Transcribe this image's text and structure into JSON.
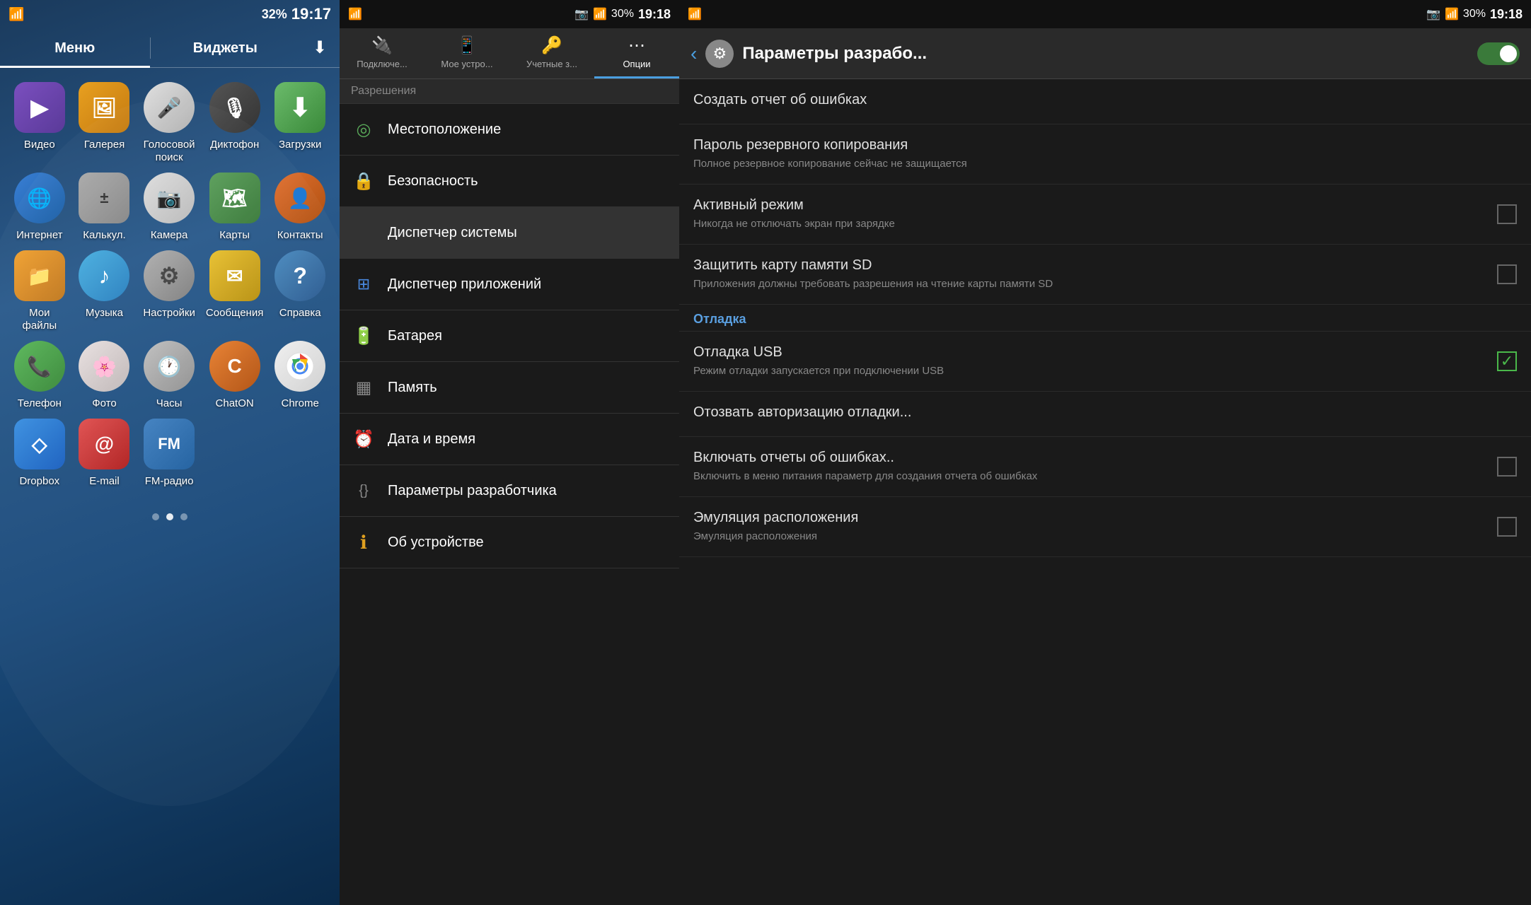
{
  "homeScreen": {
    "statusBar": {
      "time": "19:17",
      "batteryPercent": "32%",
      "wifiIcon": "wifi",
      "signalIcon": "signal"
    },
    "tabs": [
      {
        "id": "menu",
        "label": "Меню",
        "active": true
      },
      {
        "id": "widgets",
        "label": "Виджеты",
        "active": false
      }
    ],
    "downloadIcon": "⬇",
    "apps": [
      {
        "id": "video",
        "label": "Видео",
        "iconClass": "icon-video",
        "icon": "▶"
      },
      {
        "id": "gallery",
        "label": "Галерея",
        "iconClass": "icon-gallery",
        "icon": "🖼"
      },
      {
        "id": "voice",
        "label": "Голосовой поиск",
        "iconClass": "icon-voice",
        "icon": "🎤"
      },
      {
        "id": "dictaphone",
        "label": "Диктофон",
        "iconClass": "icon-dictaphone",
        "icon": "🎙"
      },
      {
        "id": "downloads",
        "label": "Загрузки",
        "iconClass": "icon-download",
        "icon": "⬇"
      },
      {
        "id": "internet",
        "label": "Интернет",
        "iconClass": "icon-internet",
        "icon": "🌐"
      },
      {
        "id": "calculator",
        "label": "Калькул.",
        "iconClass": "icon-calc",
        "icon": "±"
      },
      {
        "id": "camera",
        "label": "Камера",
        "iconClass": "icon-camera",
        "icon": "📷"
      },
      {
        "id": "maps",
        "label": "Карты",
        "iconClass": "icon-maps",
        "icon": "🗺"
      },
      {
        "id": "contacts",
        "label": "Контакты",
        "iconClass": "icon-contacts",
        "icon": "👤"
      },
      {
        "id": "myfiles",
        "label": "Мои файлы",
        "iconClass": "icon-myfiles",
        "icon": "📁"
      },
      {
        "id": "music",
        "label": "Музыка",
        "iconClass": "icon-music",
        "icon": "♪"
      },
      {
        "id": "settings",
        "label": "Настройки",
        "iconClass": "icon-settings",
        "icon": "⚙"
      },
      {
        "id": "messages",
        "label": "Сообщения",
        "iconClass": "icon-messages",
        "icon": "✉"
      },
      {
        "id": "help",
        "label": "Справка",
        "iconClass": "icon-help",
        "icon": "?"
      },
      {
        "id": "phone",
        "label": "Телефон",
        "iconClass": "icon-phone",
        "icon": "📞"
      },
      {
        "id": "photos",
        "label": "Фото",
        "iconClass": "icon-photos",
        "icon": "🌸"
      },
      {
        "id": "clock",
        "label": "Часы",
        "iconClass": "icon-clock",
        "icon": "🕐"
      },
      {
        "id": "chaton",
        "label": "ChatON",
        "iconClass": "icon-chaton",
        "icon": "C"
      },
      {
        "id": "chrome",
        "label": "Chrome",
        "iconClass": "icon-chrome",
        "icon": "◎"
      },
      {
        "id": "dropbox",
        "label": "Dropbox",
        "iconClass": "icon-dropbox",
        "icon": "◇"
      },
      {
        "id": "email",
        "label": "E-mail",
        "iconClass": "icon-email",
        "icon": "@"
      },
      {
        "id": "fmradio",
        "label": "FM-радио",
        "iconClass": "icon-fmradio",
        "icon": "📻"
      }
    ],
    "dots": [
      {
        "active": false
      },
      {
        "active": true
      },
      {
        "active": false
      }
    ]
  },
  "settingsScreen": {
    "statusBar": {
      "time": "19:18",
      "batteryPercent": "30%"
    },
    "tabs": [
      {
        "id": "connections",
        "label": "Подключе...",
        "icon": "🔌",
        "active": false
      },
      {
        "id": "mydevice",
        "label": "Мое устро...",
        "icon": "📱",
        "active": false
      },
      {
        "id": "accounts",
        "label": "Учетные з...",
        "icon": "🔑",
        "active": false
      },
      {
        "id": "options",
        "label": "Опции",
        "icon": "⋯",
        "active": true
      }
    ],
    "sectionHeader": "Разрешения",
    "items": [
      {
        "id": "location",
        "label": "Местоположение",
        "icon": "◎",
        "iconColor": "#5aaa5a",
        "active": false
      },
      {
        "id": "security",
        "label": "Безопасность",
        "icon": "🔒",
        "iconColor": "#4a8ae0",
        "active": false
      },
      {
        "id": "dispatcher",
        "label": "Диспетчер системы",
        "icon": null,
        "iconColor": null,
        "active": true
      },
      {
        "id": "appmanager",
        "label": "Диспетчер приложений",
        "icon": "⊞",
        "iconColor": "#4a8ae0",
        "active": false
      },
      {
        "id": "battery",
        "label": "Батарея",
        "icon": "🔋",
        "iconColor": "#5aaa5a",
        "active": false
      },
      {
        "id": "memory",
        "label": "Память",
        "icon": "▦",
        "iconColor": "#888",
        "active": false
      },
      {
        "id": "datetime",
        "label": "Дата и время",
        "icon": "⏰",
        "iconColor": "#888",
        "active": false
      },
      {
        "id": "developer",
        "label": "Параметры разработчика",
        "icon": "{}",
        "iconColor": "#888",
        "active": false
      },
      {
        "id": "about",
        "label": "Об устройстве",
        "icon": "ℹ",
        "iconColor": "#e0a020",
        "active": false
      }
    ]
  },
  "devScreen": {
    "statusBar": {
      "time": "19:18",
      "batteryPercent": "30%"
    },
    "header": {
      "title": "Параметры разрабо...",
      "backLabel": "‹",
      "toggleEnabled": true
    },
    "items": [
      {
        "type": "item",
        "id": "create-report",
        "title": "Создать отчет об ошибках",
        "subtitle": "",
        "hasCheckbox": false,
        "checked": false
      },
      {
        "type": "item",
        "id": "backup-password",
        "title": "Пароль резервного копирования",
        "subtitle": "Полное резервное копирование сейчас не защищается",
        "hasCheckbox": false,
        "checked": false
      },
      {
        "type": "item",
        "id": "active-mode",
        "title": "Активный режим",
        "subtitle": "Никогда не отключать экран при зарядке",
        "hasCheckbox": true,
        "checked": false
      },
      {
        "type": "item",
        "id": "protect-sd",
        "title": "Защитить карту памяти SD",
        "subtitle": "Приложения должны требовать разрешения на чтение карты памяти SD",
        "hasCheckbox": true,
        "checked": false
      },
      {
        "type": "section",
        "id": "debug-section",
        "label": "Отладка"
      },
      {
        "type": "item",
        "id": "usb-debug",
        "title": "Отладка USB",
        "subtitle": "Режим отладки запускается при подключении USB",
        "hasCheckbox": true,
        "checked": true
      },
      {
        "type": "item",
        "id": "revoke-auth",
        "title": "Отозвать авторизацию отладки...",
        "subtitle": "",
        "hasCheckbox": false,
        "checked": false
      },
      {
        "type": "item",
        "id": "error-reports",
        "title": "Включать отчеты об ошибках..",
        "subtitle": "Включить в меню питания параметр для создания отчета об ошибках",
        "hasCheckbox": true,
        "checked": false
      },
      {
        "type": "item",
        "id": "emulation",
        "title": "Эмуляция расположения",
        "subtitle": "Эмуляция расположения",
        "hasCheckbox": true,
        "checked": false
      }
    ]
  }
}
